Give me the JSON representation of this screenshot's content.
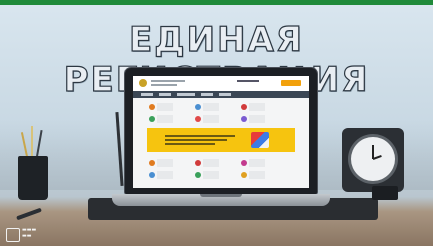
{
  "headline": {
    "text": "ЕДИНАЯ РЕГИСТРАЦИЯ"
  },
  "theme": {
    "top_bar_color": "#1f8a3a",
    "banner_color": "#f6c40f",
    "header_button_color": "#f2a10c"
  },
  "icons": [
    "clock-icon",
    "laptop-icon",
    "pencil-cup-icon",
    "watermark-logo-icon"
  ]
}
